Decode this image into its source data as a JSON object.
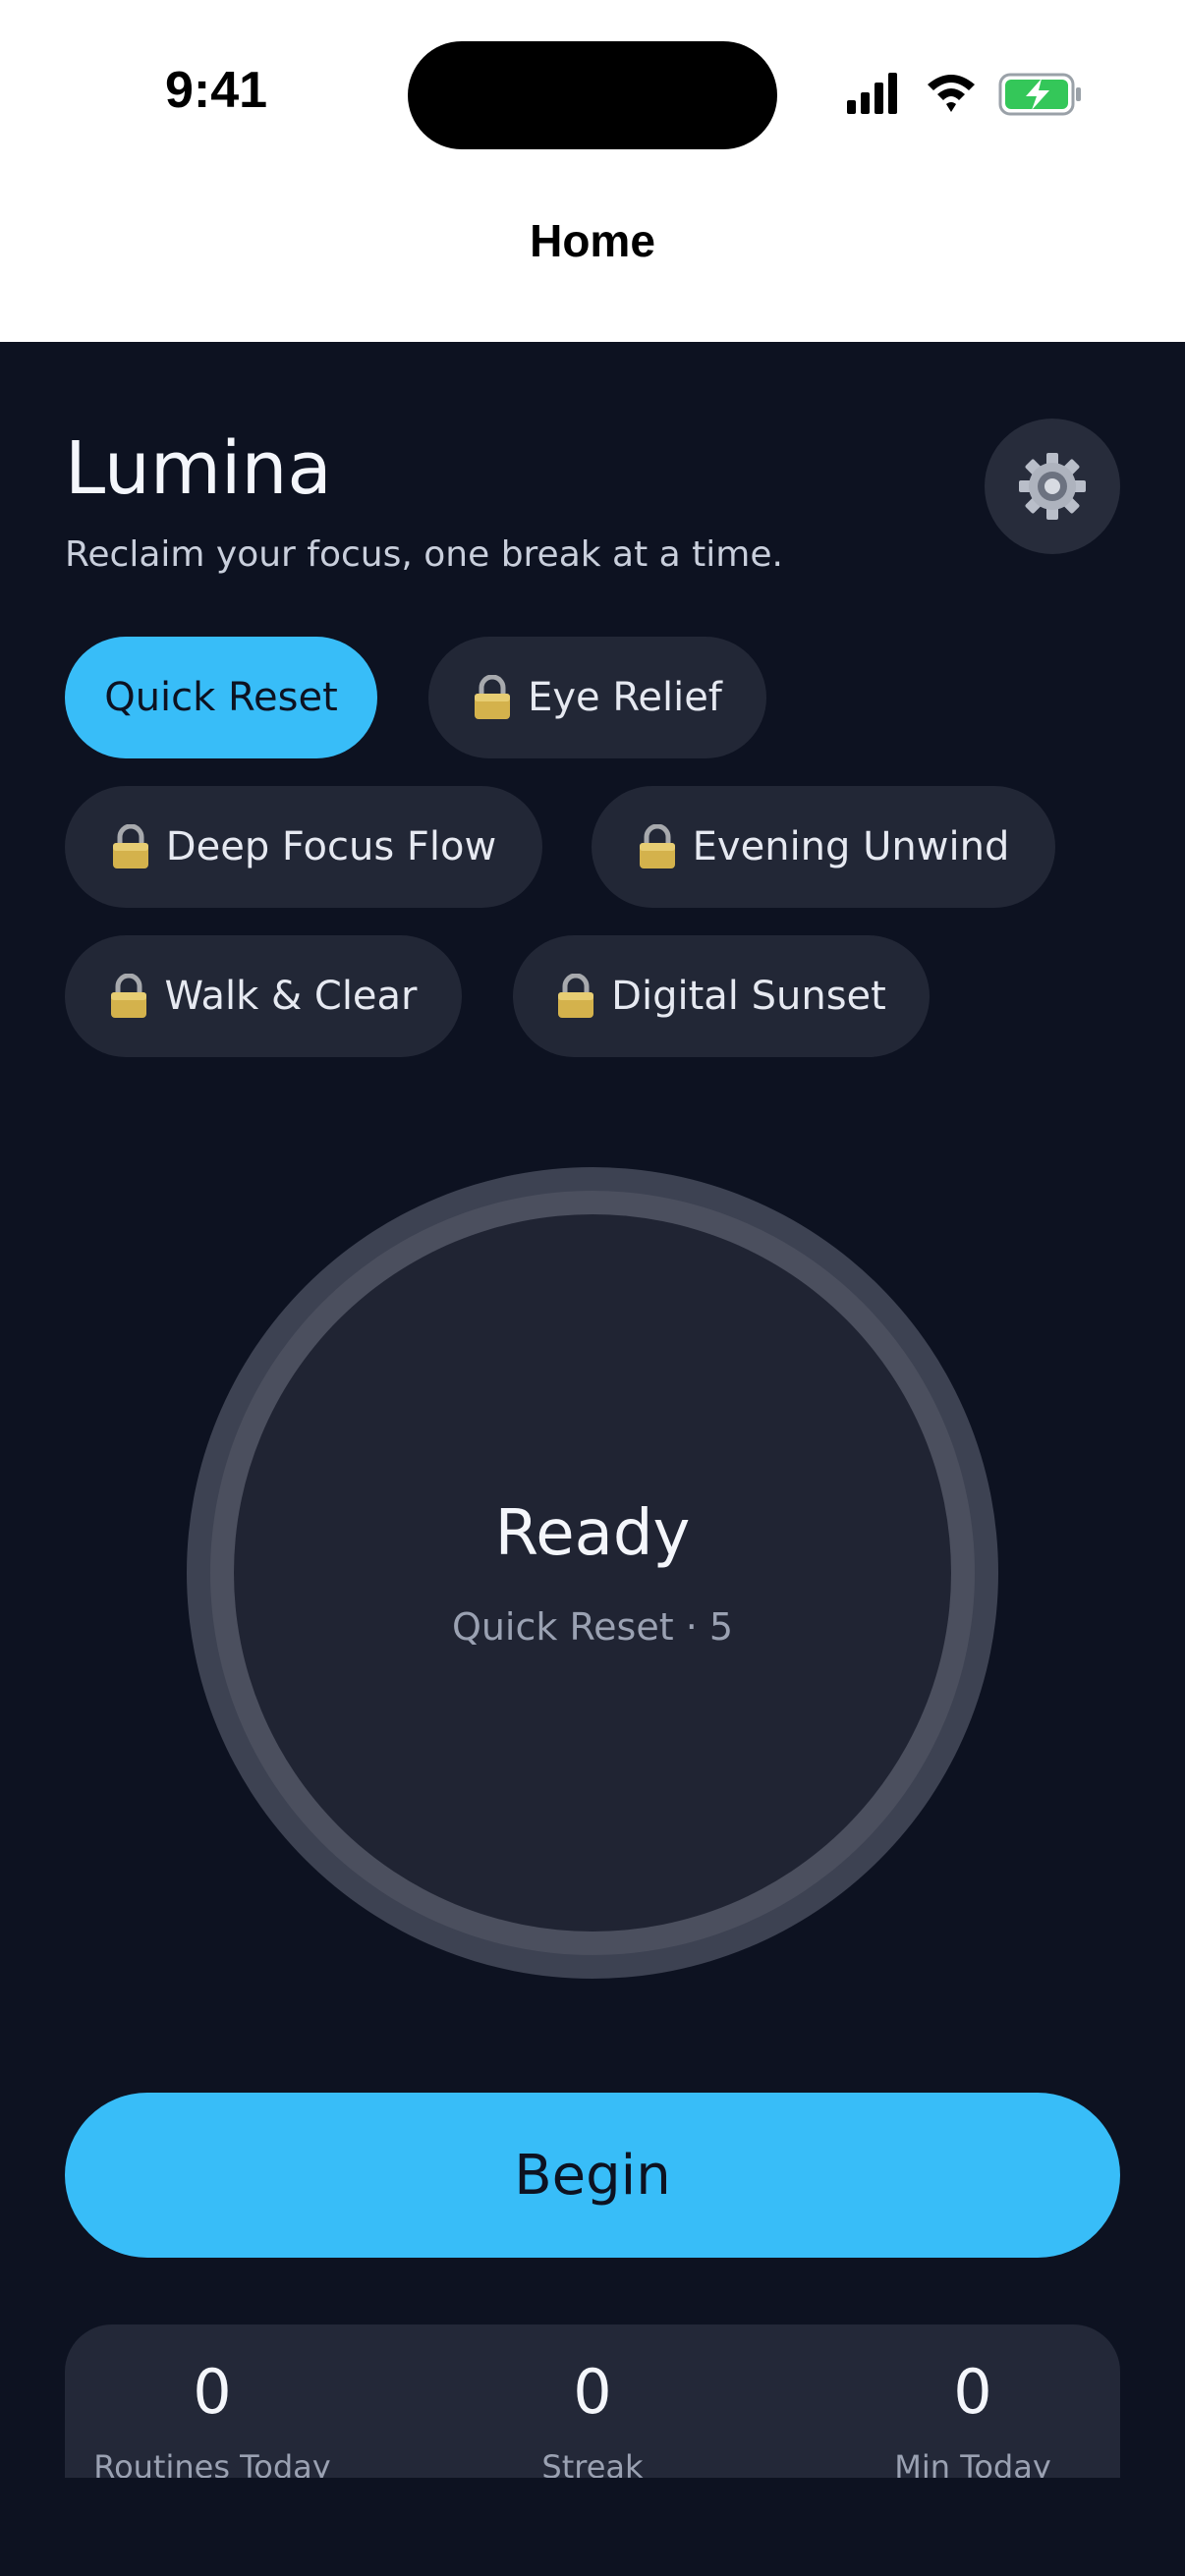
{
  "status_bar": {
    "time": "9:41"
  },
  "nav": {
    "title": "Home"
  },
  "header": {
    "app_title": "Lumina",
    "subtitle": "Reclaim your focus, one break at a time."
  },
  "chips": [
    {
      "label": "Quick Reset",
      "locked": false,
      "active": true
    },
    {
      "label": "Eye Relief",
      "locked": true,
      "active": false
    },
    {
      "label": "Deep Focus Flow",
      "locked": true,
      "active": false
    },
    {
      "label": "Evening Unwind",
      "locked": true,
      "active": false
    },
    {
      "label": "Walk & Clear",
      "locked": true,
      "active": false
    },
    {
      "label": "Digital Sunset",
      "locked": true,
      "active": false
    }
  ],
  "timer": {
    "state": "Ready",
    "detail": "Quick Reset · 5"
  },
  "begin_label": "Begin",
  "stats": [
    {
      "value": "0",
      "label": "Routines Today"
    },
    {
      "value": "0",
      "label": "Streak"
    },
    {
      "value": "0",
      "label": "Min Today"
    }
  ],
  "colors": {
    "background": "#0d1221",
    "accent": "#38bdf8",
    "chip": "#222736"
  },
  "icons": {
    "settings": "gear-icon",
    "lock": "lock-icon",
    "signal": "signal-icon",
    "wifi": "wifi-icon",
    "battery": "battery-charging-icon"
  }
}
